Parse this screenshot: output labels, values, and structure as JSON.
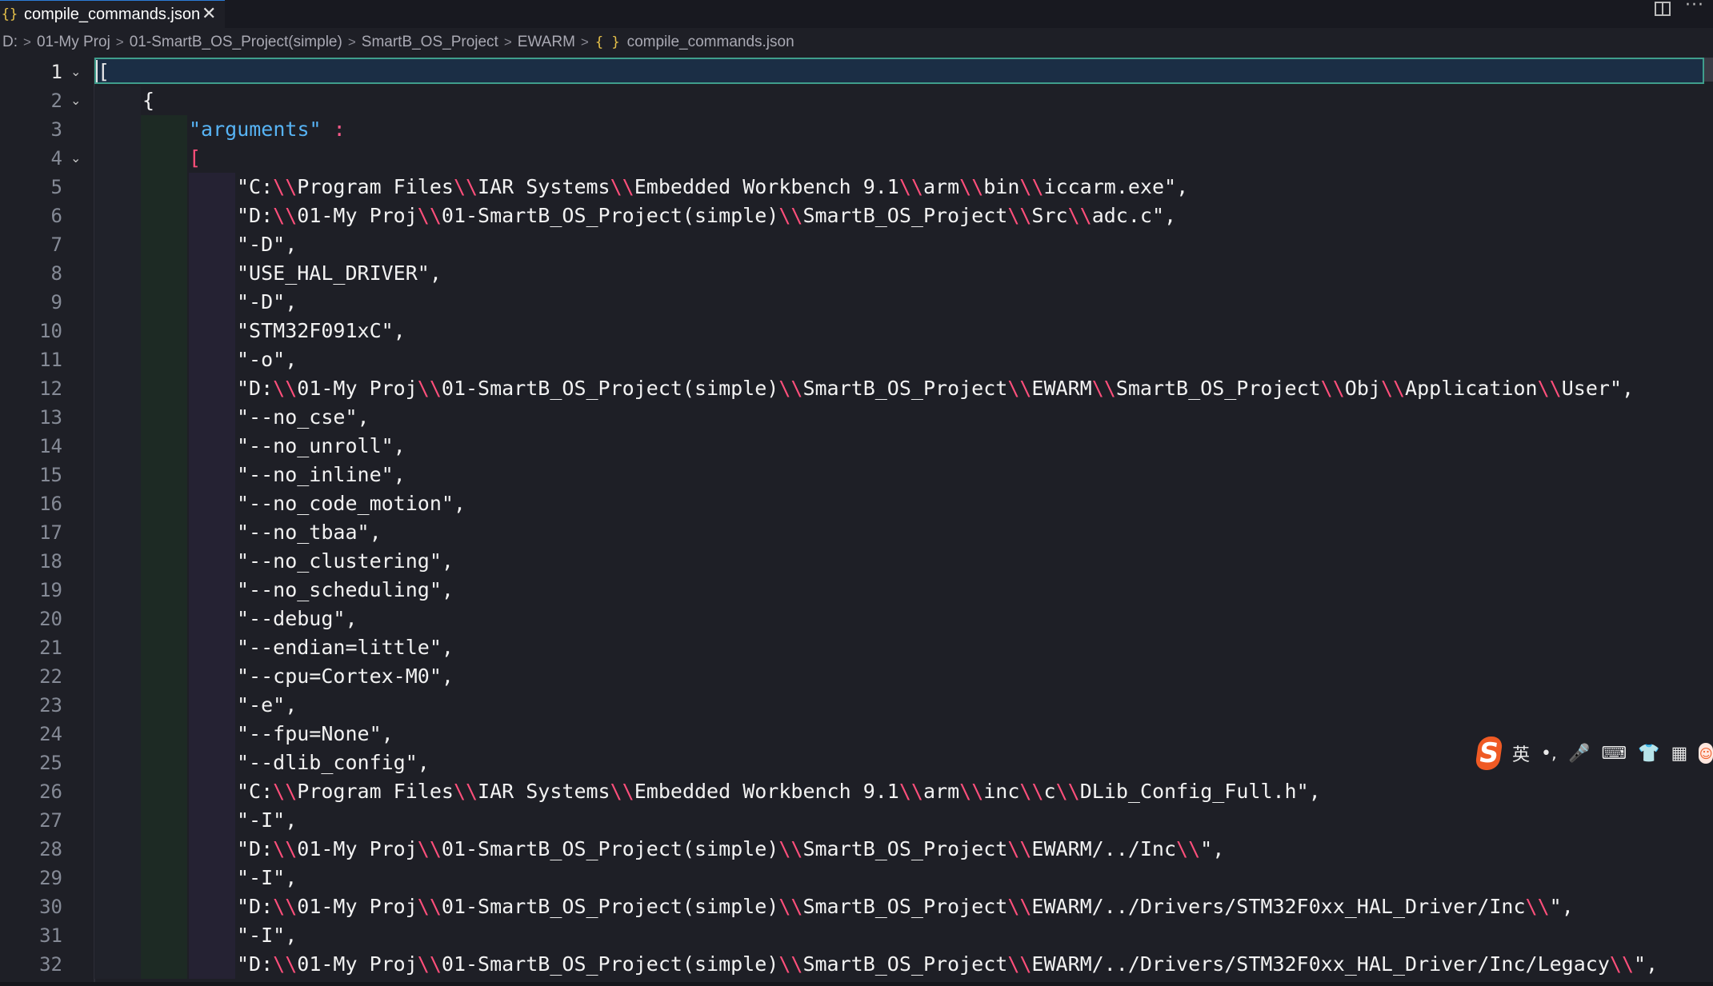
{
  "tab": {
    "icon": "json-braces-icon",
    "label": "compile_commands.json",
    "close": "✕"
  },
  "titlebar_actions": {
    "split_icon": "split-editor-icon",
    "more": "···"
  },
  "breadcrumb": {
    "items": [
      "D:",
      "01-My Proj",
      "01-SmartB_OS_Project(simple)",
      "SmartB_OS_Project",
      "EWARM"
    ],
    "file_icon": "{ }",
    "file": "compile_commands.json"
  },
  "editor": {
    "active_line": 1,
    "lines": [
      {
        "n": "1",
        "text": "["
      },
      {
        "n": "2",
        "text": "{"
      },
      {
        "n": "3",
        "key": "\"arguments\"",
        "colon": " :"
      },
      {
        "n": "4",
        "text": "["
      },
      {
        "n": "5",
        "text": "\"C:\\\\Program Files\\\\IAR Systems\\\\Embedded Workbench 9.1\\\\arm\\\\bin\\\\iccarm.exe\","
      },
      {
        "n": "6",
        "text": "\"D:\\\\01-My Proj\\\\01-SmartB_OS_Project(simple)\\\\SmartB_OS_Project\\\\Src\\\\adc.c\","
      },
      {
        "n": "7",
        "text": "\"-D\","
      },
      {
        "n": "8",
        "text": "\"USE_HAL_DRIVER\","
      },
      {
        "n": "9",
        "text": "\"-D\","
      },
      {
        "n": "10",
        "text": "\"STM32F091xC\","
      },
      {
        "n": "11",
        "text": "\"-o\","
      },
      {
        "n": "12",
        "text": "\"D:\\\\01-My Proj\\\\01-SmartB_OS_Project(simple)\\\\SmartB_OS_Project\\\\EWARM\\\\SmartB_OS_Project\\\\Obj\\\\Application\\\\User\","
      },
      {
        "n": "13",
        "text": "\"--no_cse\","
      },
      {
        "n": "14",
        "text": "\"--no_unroll\","
      },
      {
        "n": "15",
        "text": "\"--no_inline\","
      },
      {
        "n": "16",
        "text": "\"--no_code_motion\","
      },
      {
        "n": "17",
        "text": "\"--no_tbaa\","
      },
      {
        "n": "18",
        "text": "\"--no_clustering\","
      },
      {
        "n": "19",
        "text": "\"--no_scheduling\","
      },
      {
        "n": "20",
        "text": "\"--debug\","
      },
      {
        "n": "21",
        "text": "\"--endian=little\","
      },
      {
        "n": "22",
        "text": "\"--cpu=Cortex-M0\","
      },
      {
        "n": "23",
        "text": "\"-e\","
      },
      {
        "n": "24",
        "text": "\"--fpu=None\","
      },
      {
        "n": "25",
        "text": "\"--dlib_config\","
      },
      {
        "n": "26",
        "text": "\"C:\\\\Program Files\\\\IAR Systems\\\\Embedded Workbench 9.1\\\\arm\\\\inc\\\\c\\\\DLib_Config_Full.h\","
      },
      {
        "n": "27",
        "text": "\"-I\","
      },
      {
        "n": "28",
        "text": "\"D:\\\\01-My Proj\\\\01-SmartB_OS_Project(simple)\\\\SmartB_OS_Project\\\\EWARM/../Inc\\\\\","
      },
      {
        "n": "29",
        "text": "\"-I\","
      },
      {
        "n": "30",
        "text": "\"D:\\\\01-My Proj\\\\01-SmartB_OS_Project(simple)\\\\SmartB_OS_Project\\\\EWARM/../Drivers/STM32F0xx_HAL_Driver/Inc\\\\\","
      },
      {
        "n": "31",
        "text": "\"-I\","
      },
      {
        "n": "32",
        "text": "\"D:\\\\01-My Proj\\\\01-SmartB_OS_Project(simple)\\\\SmartB_OS_Project\\\\EWARM/../Drivers/STM32F0xx_HAL_Driver/Inc/Legacy\\\\\","
      }
    ]
  },
  "ime": {
    "logo": "S",
    "mode": "英",
    "punct": "•,",
    "mic_icon": "🎤",
    "keyboard_icon": "⌨",
    "skin_icon": "👕",
    "grid_icon": "▦",
    "avatar": "☺"
  },
  "colors": {
    "background": "#1e1f26",
    "key": "#57b3f4",
    "punctuation_pink": "#ff4f7b",
    "current_line_border": "#3f9e8c",
    "ime_accent": "#ef5a24"
  }
}
